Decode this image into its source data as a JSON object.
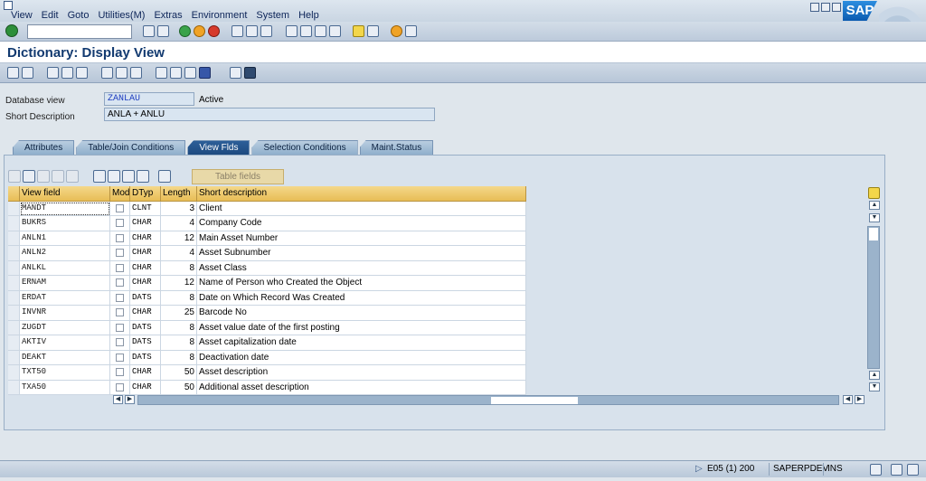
{
  "menu": [
    "View",
    "Edit",
    "Goto",
    "Utilities(M)",
    "Extras",
    "Environment",
    "System",
    "Help"
  ],
  "brand": "SAP",
  "title": "Dictionary: Display View",
  "header": {
    "db_view_label": "Database view",
    "db_view_value": "ZANLAU",
    "db_view_status": "Active",
    "short_desc_label": "Short Description",
    "short_desc_value": "ANLA + ANLU"
  },
  "tabs": [
    {
      "label": "Attributes",
      "active": false
    },
    {
      "label": "Table/Join Conditions",
      "active": false
    },
    {
      "label": "View Flds",
      "active": true
    },
    {
      "label": "Selection Conditions",
      "active": false
    },
    {
      "label": "Maint.Status",
      "active": false
    }
  ],
  "table_fields_button": "Table fields",
  "columns": [
    "View field",
    "Mod",
    "DTyp",
    "Length",
    "Short description"
  ],
  "rows": [
    {
      "field": "MANDT",
      "dtyp": "CLNT",
      "length": "3",
      "desc": "Client"
    },
    {
      "field": "BUKRS",
      "dtyp": "CHAR",
      "length": "4",
      "desc": "Company Code"
    },
    {
      "field": "ANLN1",
      "dtyp": "CHAR",
      "length": "12",
      "desc": "Main Asset Number"
    },
    {
      "field": "ANLN2",
      "dtyp": "CHAR",
      "length": "4",
      "desc": "Asset Subnumber"
    },
    {
      "field": "ANLKL",
      "dtyp": "CHAR",
      "length": "8",
      "desc": "Asset Class"
    },
    {
      "field": "ERNAM",
      "dtyp": "CHAR",
      "length": "12",
      "desc": "Name of Person who Created the Object"
    },
    {
      "field": "ERDAT",
      "dtyp": "DATS",
      "length": "8",
      "desc": "Date on Which Record Was Created"
    },
    {
      "field": "INVNR",
      "dtyp": "CHAR",
      "length": "25",
      "desc": "Barcode No"
    },
    {
      "field": "ZUGDT",
      "dtyp": "DATS",
      "length": "8",
      "desc": "Asset value date of the first posting"
    },
    {
      "field": "AKTIV",
      "dtyp": "DATS",
      "length": "8",
      "desc": "Asset capitalization date"
    },
    {
      "field": "DEAKT",
      "dtyp": "DATS",
      "length": "8",
      "desc": "Deactivation date"
    },
    {
      "field": "TXT50",
      "dtyp": "CHAR",
      "length": "50",
      "desc": "Asset description"
    },
    {
      "field": "TXA50",
      "dtyp": "CHAR",
      "length": "50",
      "desc": "Additional asset description"
    }
  ],
  "status": {
    "system": "E05 (1) 200",
    "server": "SAPERPDEV",
    "mode": "INS"
  }
}
